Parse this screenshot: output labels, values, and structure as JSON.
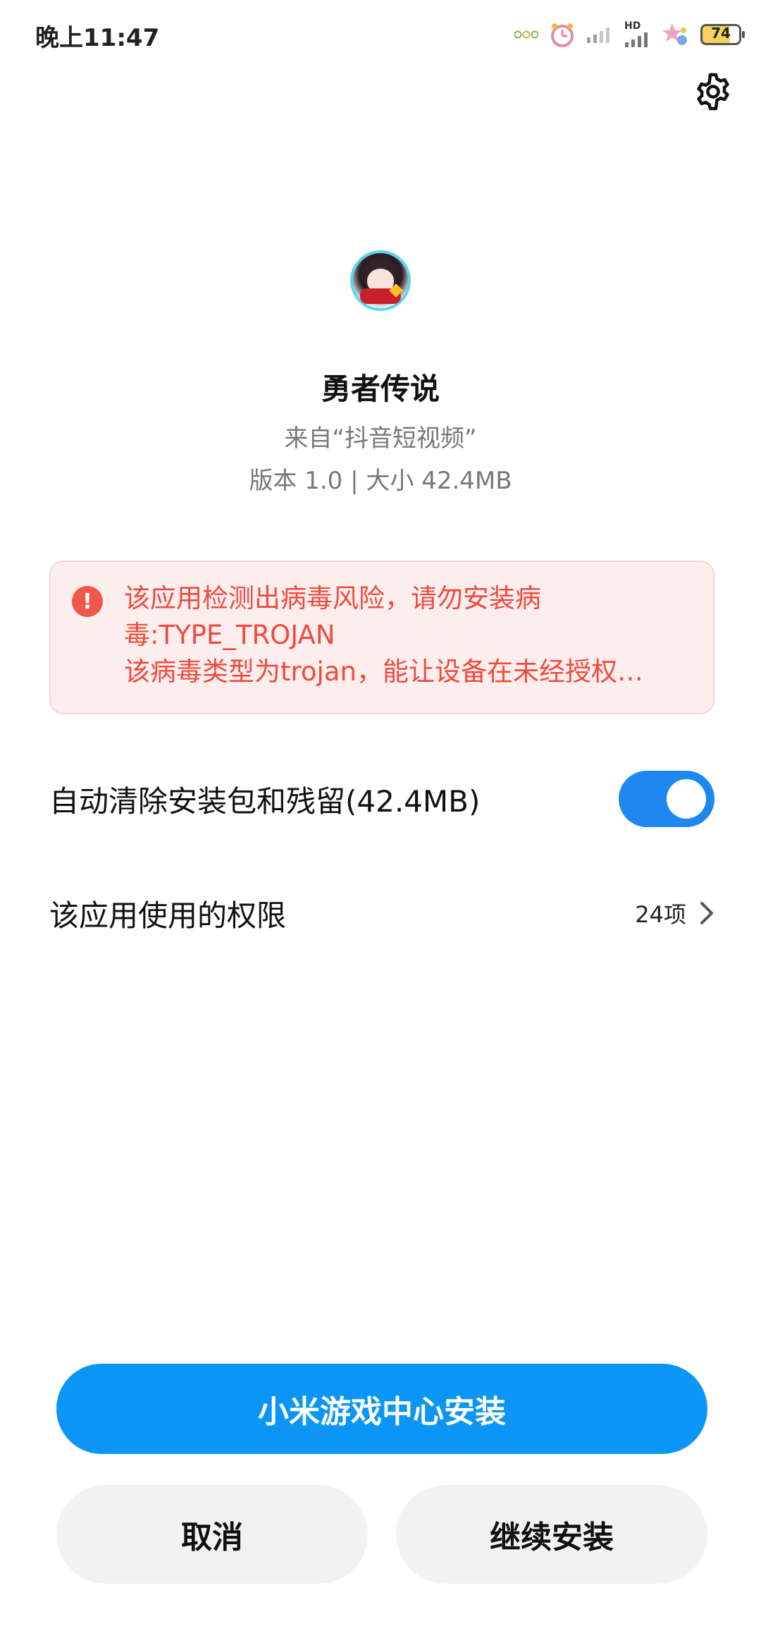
{
  "status_bar": {
    "time": "晚上11:47",
    "network_label": "HD",
    "battery_level": "74",
    "icons": [
      "notification-dots-icon",
      "alarm-icon",
      "signal-icon",
      "hd-signal-icon",
      "app-notification-icon",
      "battery-icon"
    ]
  },
  "app": {
    "name": "勇者传说",
    "source": "来自“抖音短视频”",
    "meta": "版本 1.0 | 大小 42.4MB"
  },
  "warning": {
    "line1": "该应用检测出病毒风险，请勿安装病",
    "line2": "毒:TYPE_TROJAN",
    "line3": "该病毒类型为trojan，能让设备在未经授权…",
    "icon_glyph": "!",
    "color": "#ee4b3e"
  },
  "settings": {
    "auto_clean_label": "自动清除安装包和残留(42.4MB)",
    "auto_clean_enabled": true,
    "permissions_label": "该应用使用的权限",
    "permissions_count": "24项"
  },
  "buttons": {
    "primary": "小米游戏中心安装",
    "cancel": "取消",
    "continue": "继续安装"
  },
  "colors": {
    "accent": "#0b96f5",
    "toggle_on": "#1e88f0",
    "warning_bg": "#fdeeee"
  }
}
